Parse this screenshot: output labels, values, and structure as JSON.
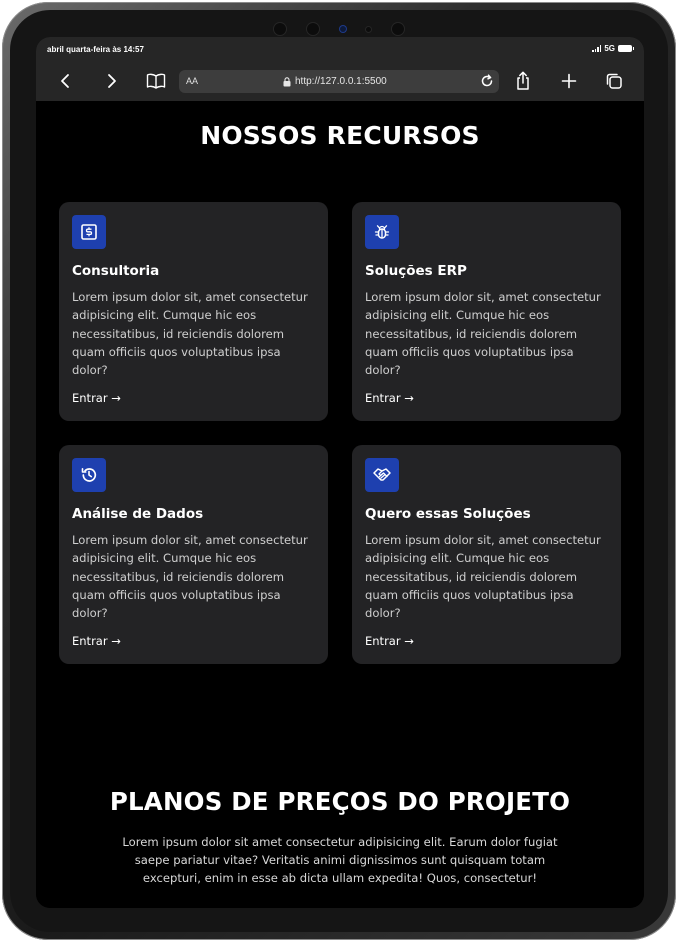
{
  "status_bar": {
    "datetime": "abril quarta-feira às 14:57",
    "network": "5G"
  },
  "browser": {
    "text_size_label": "AA",
    "url": "http://127.0.0.1:5500",
    "icons": [
      "chevron-left-icon",
      "chevron-right-icon",
      "book-icon",
      "lock-icon",
      "reload-icon",
      "share-icon",
      "plus-icon",
      "tabs-icon"
    ]
  },
  "resources": {
    "title": "NOSSOS RECURSOS",
    "cards": [
      {
        "icon": "money-icon",
        "title": "Consultoria",
        "text": "Lorem ipsum dolor sit, amet consectetur adipisicing elit. Cumque hic eos necessitatibus, id reiciendis dolorem quam officiis quos voluptatibus ipsa dolor?",
        "link": "Entrar →"
      },
      {
        "icon": "bug-icon",
        "title": "Soluções ERP",
        "text": "Lorem ipsum dolor sit, amet consectetur adipisicing elit. Cumque hic eos necessitatibus, id reiciendis dolorem quam officiis quos voluptatibus ipsa dolor?",
        "link": "Entrar →"
      },
      {
        "icon": "history-icon",
        "title": "Análise de Dados",
        "text": "Lorem ipsum dolor sit, amet consectetur adipisicing elit. Cumque hic eos necessitatibus, id reiciendis dolorem quam officiis quos voluptatibus ipsa dolor?",
        "link": "Entrar →"
      },
      {
        "icon": "handshake-icon",
        "title": "Quero essas Soluções",
        "text": "Lorem ipsum dolor sit, amet consectetur adipisicing elit. Cumque hic eos necessitatibus, id reiciendis dolorem quam officiis quos voluptatibus ipsa dolor?",
        "link": "Entrar →"
      }
    ]
  },
  "pricing": {
    "title": "PLANOS DE PREÇOS DO PROJETO",
    "text": "Lorem ipsum dolor sit amet consectetur adipisicing elit. Earum dolor fugiat saepe pariatur vitae? Veritatis animi dignissimos sunt quisquam totam excepturi, enim in esse ab dicta ullam expedita! Quos, consectetur!"
  },
  "colors": {
    "background": "#000000",
    "card": "#232325",
    "icon_accent": "#1e40af",
    "browser_chrome": "#262626"
  }
}
